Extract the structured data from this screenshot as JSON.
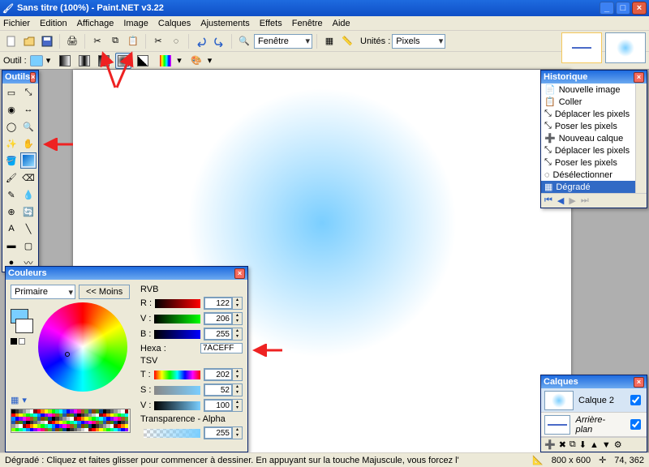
{
  "title": "Sans titre (100%) - Paint.NET v3.22",
  "menu": [
    "Fichier",
    "Edition",
    "Affichage",
    "Image",
    "Calques",
    "Ajustements",
    "Effets",
    "Fenêtre",
    "Aide"
  ],
  "toolbar": {
    "window_label": "Fenêtre",
    "units_label": "Unités :",
    "units_value": "Pixels"
  },
  "tool_opts": {
    "label": "Outil :"
  },
  "panels": {
    "tools_title": "Outils",
    "history_title": "Historique",
    "layers_title": "Calques",
    "colors_title": "Couleurs"
  },
  "history": {
    "items": [
      "Nouvelle image",
      "Coller",
      "Déplacer les pixels",
      "Poser les pixels",
      "Nouveau calque",
      "Déplacer les pixels",
      "Poser les pixels",
      "Désélectionner",
      "Dégradé"
    ],
    "selected_index": 8
  },
  "layers": {
    "items": [
      {
        "name": "Calque 2",
        "checked": true
      },
      {
        "name": "Arrière-plan",
        "checked": true
      }
    ]
  },
  "colors": {
    "selector_value": "Primaire",
    "less_label": "<< Moins",
    "rvb_label": "RVB",
    "tsv_label": "TSV",
    "alpha_label": "Transparence - Alpha",
    "hexa_label": "Hexa :",
    "R_label": "R :",
    "V_label": "V :",
    "B_label": "B :",
    "T_label": "T :",
    "S_label": "S :",
    "Vv_label": "V :",
    "R": 122,
    "V": 206,
    "B": 255,
    "T": 202,
    "S": 52,
    "Vv": 100,
    "A": 255,
    "Hex": "7ACEFF"
  },
  "status": {
    "hint": "Dégradé : Cliquez et faites glisser pour commencer à dessiner. En appuyant sur la touche Majuscule, vous forcez l'angle. Le bouton droit inverse les coule",
    "dims": "800 x 600",
    "pos": "74, 362"
  },
  "icons": {
    "new": "new-icon",
    "open": "open-icon",
    "save": "save-icon",
    "cut": "cut-icon",
    "copy": "copy-icon",
    "paste": "paste-icon",
    "undo": "undo-icon",
    "redo": "redo-icon",
    "zoom": "zoom-icon",
    "grid": "grid-icon"
  }
}
